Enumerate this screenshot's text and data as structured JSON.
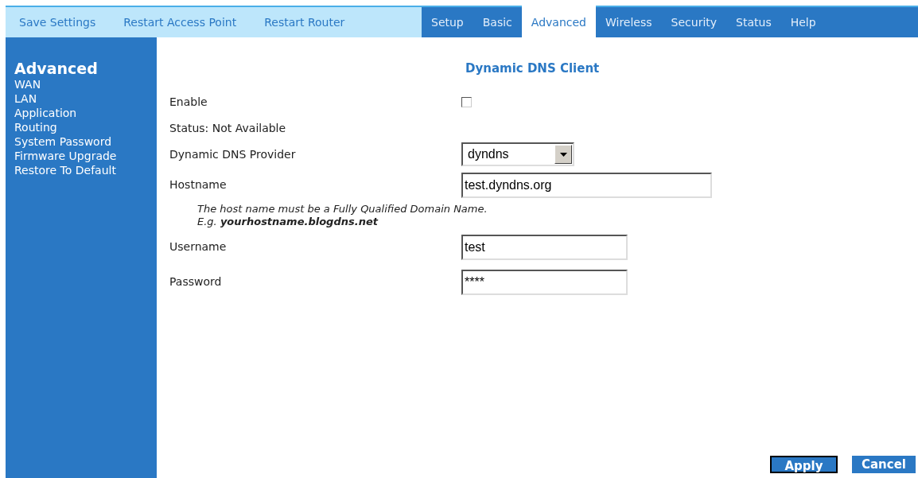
{
  "actions": [
    "Save Settings",
    "Restart Access Point",
    "Restart Router"
  ],
  "tabs": [
    {
      "label": "Setup",
      "selected": false
    },
    {
      "label": "Basic",
      "selected": false
    },
    {
      "label": "Advanced",
      "selected": true
    },
    {
      "label": "Wireless",
      "selected": false
    },
    {
      "label": "Security",
      "selected": false
    },
    {
      "label": "Status",
      "selected": false
    },
    {
      "label": "Help",
      "selected": false
    }
  ],
  "sidebar": {
    "title": "Advanced",
    "items": [
      "WAN",
      "LAN",
      "Application",
      "Routing",
      "System Password",
      "Firmware Upgrade",
      "Restore To Default"
    ]
  },
  "form": {
    "title": "Dynamic DNS Client",
    "rows": [
      {
        "kind": "checkbox",
        "label": "Enable",
        "checked": false
      },
      {
        "kind": "text",
        "label": "Status: Not Available"
      },
      {
        "kind": "select",
        "label": "Dynamic DNS Provider",
        "value": "dyndns"
      },
      {
        "kind": "long-input",
        "label": "Hostname",
        "value": "test.dyndns.org"
      },
      {
        "kind": "note",
        "lines": [
          "The host name must be a Fully Qualified Domain Name.",
          "E.g. **yourhostname.blogdns.net**"
        ]
      },
      {
        "kind": "input",
        "label": "Username",
        "value": "test"
      },
      {
        "kind": "input",
        "label": "Password",
        "value": "****"
      }
    ]
  },
  "buttons": [
    {
      "label": "Apply",
      "focused": true
    },
    {
      "label": "Cancel",
      "focused": false
    }
  ]
}
